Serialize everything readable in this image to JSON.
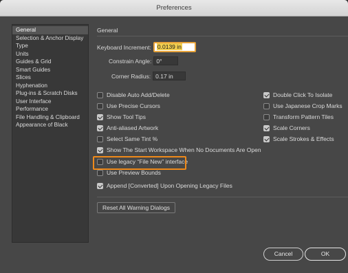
{
  "window": {
    "title": "Preferences"
  },
  "sidebar": {
    "items": [
      {
        "label": "General",
        "selected": true
      },
      {
        "label": "Selection & Anchor Display"
      },
      {
        "label": "Type"
      },
      {
        "label": "Units"
      },
      {
        "label": "Guides & Grid"
      },
      {
        "label": "Smart Guides"
      },
      {
        "label": "Slices"
      },
      {
        "label": "Hyphenation"
      },
      {
        "label": "Plug-ins & Scratch Disks"
      },
      {
        "label": "User Interface"
      },
      {
        "label": "Performance"
      },
      {
        "label": "File Handling & Clipboard"
      },
      {
        "label": "Appearance of Black"
      }
    ]
  },
  "panel": {
    "title": "General",
    "keyboard_increment": {
      "label": "Keyboard Increment:",
      "value": "0.0139 in"
    },
    "constrain_angle": {
      "label": "Constrain Angle:",
      "value": "0°"
    },
    "corner_radius": {
      "label": "Corner Radius:",
      "value": "0.17 in"
    },
    "checkboxes_left": [
      {
        "label": "Disable Auto Add/Delete",
        "checked": false
      },
      {
        "label": "Use Precise Cursors",
        "checked": false
      },
      {
        "label": "Show Tool Tips",
        "checked": true
      },
      {
        "label": "Anti-aliased Artwork",
        "checked": true
      },
      {
        "label": "Select Same Tint %",
        "checked": false
      },
      {
        "label": "Show The Start Workspace When No Documents Are Open",
        "checked": true
      },
      {
        "label": "Use legacy “File New” interface",
        "checked": false
      },
      {
        "label": "Use Preview Bounds",
        "checked": false
      },
      {
        "label": "Append [Converted] Upon Opening Legacy Files",
        "checked": true
      }
    ],
    "checkboxes_right": [
      {
        "label": "Double Click To Isolate",
        "checked": true
      },
      {
        "label": "Use Japanese Crop Marks",
        "checked": false
      },
      {
        "label": "Transform Pattern Tiles",
        "checked": false
      },
      {
        "label": "Scale Corners",
        "checked": true
      },
      {
        "label": "Scale Strokes & Effects",
        "checked": true
      }
    ],
    "reset_button": "Reset All Warning Dialogs"
  },
  "footer": {
    "cancel": "Cancel",
    "ok": "OK"
  },
  "colors": {
    "highlight_outline": "#f08a1a",
    "field_focus": "#e8a33a"
  }
}
